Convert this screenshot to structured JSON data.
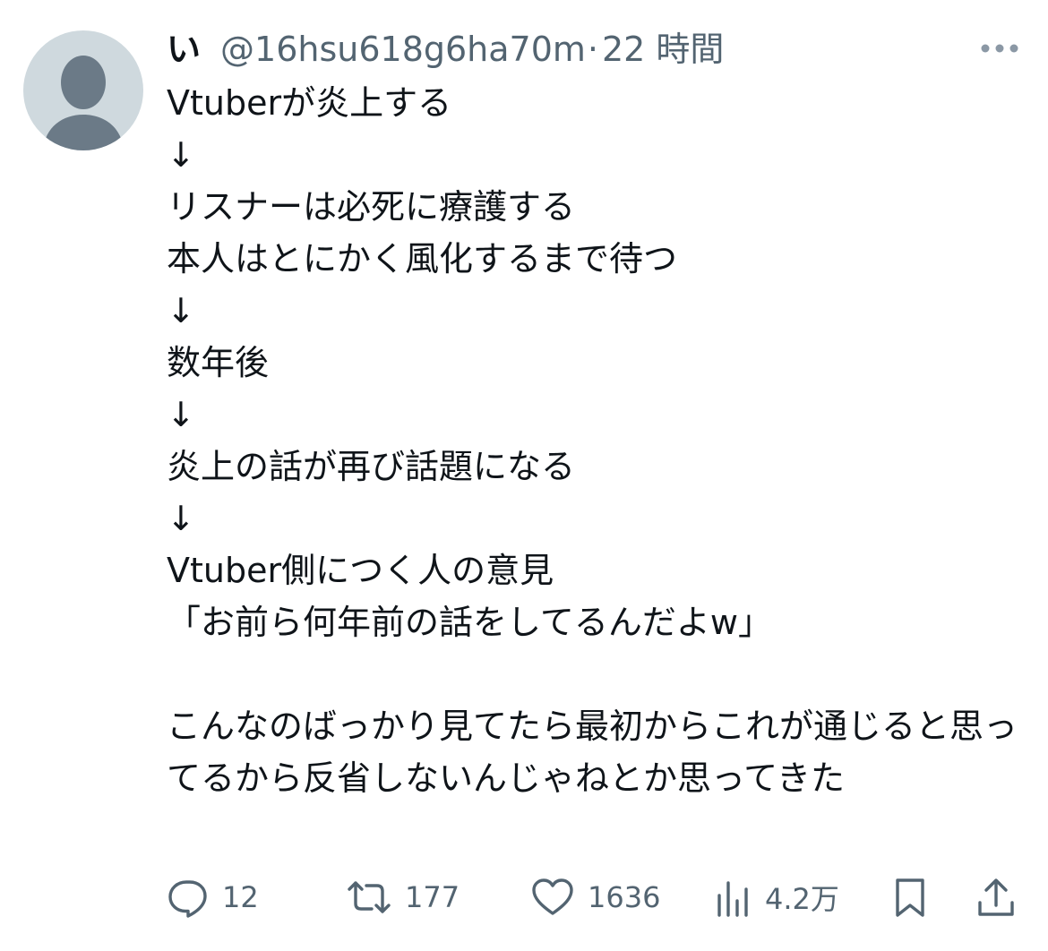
{
  "tweet": {
    "author": {
      "display_name": "い",
      "handle": "@16hsu618g6ha70m",
      "separator": "·",
      "time": "22 時間"
    },
    "text": "Vtuberが炎上する\n↓\nリスナーは必死に療護する\n本人はとにかく風化するまで待つ\n↓\n数年後\n↓\n炎上の話が再び話題になる\n↓\nVtuber側につく人の意見\n「お前ら何年前の話をしてるんだよw」\n\nこんなのばっかり見てたら最初からこれが通じると思ってるから反省しないんじゃねとか思ってきた",
    "actions": {
      "replies": "12",
      "retweets": "177",
      "likes": "1636",
      "views": "4.2万"
    }
  },
  "icons": {
    "avatar": "default-avatar-icon",
    "more": "more-dots-icon",
    "reply": "reply-icon",
    "retweet": "retweet-icon",
    "like": "heart-icon",
    "views": "views-icon",
    "bookmark": "bookmark-icon",
    "share": "share-icon"
  },
  "colors": {
    "text": "#0f1419",
    "secondary": "#536471",
    "avatar_bg": "#cfd9de",
    "avatar_fg": "#6b7a87"
  }
}
